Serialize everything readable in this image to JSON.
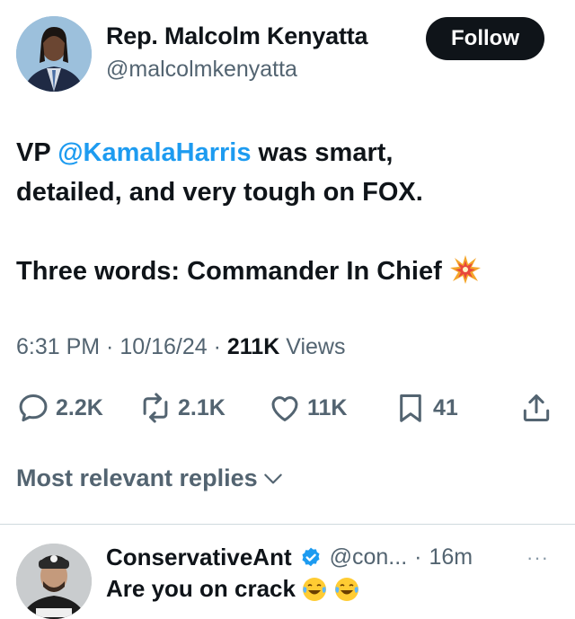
{
  "author": {
    "name": "Rep. Malcolm Kenyatta",
    "handle": "@malcolmkenyatta"
  },
  "follow_label": "Follow",
  "tweet": {
    "prefix": "VP ",
    "mention": "@KamalaHarris",
    "line1_rest": " was smart,",
    "line2": "detailed, and very tough on FOX.",
    "line3": "Three words: Commander In Chief",
    "emoji": "collision-emoji"
  },
  "meta": {
    "time": "6:31 PM",
    "date": "10/16/24",
    "views_count": "211K",
    "views_label": "Views"
  },
  "actions": {
    "replies": "2.2K",
    "reposts": "2.1K",
    "likes": "11K",
    "bookmarks": "41"
  },
  "replies_sort_label": "Most relevant replies",
  "reply": {
    "name": "ConservativeAnt",
    "handle": "@con...",
    "time": "16m",
    "text": "Are you on crack",
    "emojis": [
      "tears-of-joy-emoji",
      "tears-of-joy-emoji"
    ],
    "more_label": "···"
  },
  "colors": {
    "link": "#1d9bf0",
    "muted": "#536471",
    "text": "#0f1419",
    "verified": "#1d9bf0"
  }
}
